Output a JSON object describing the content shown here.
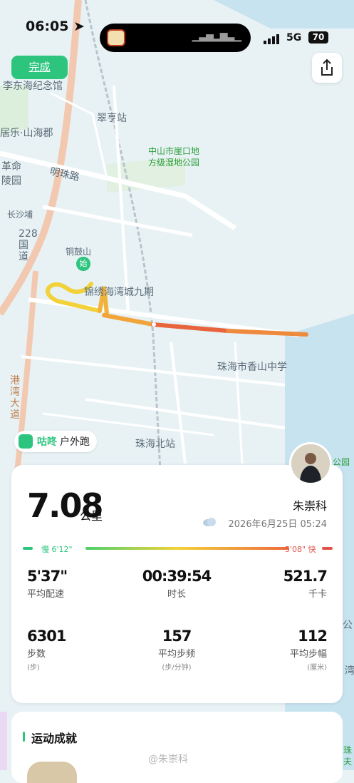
{
  "status_bar": {
    "time": "06:05",
    "network": "5G",
    "battery": "70"
  },
  "top_controls": {
    "done_label": "完成",
    "share_icon": "share-icon"
  },
  "map": {
    "labels": {
      "l1": "李东海纪念馆",
      "l2": "居乐·山海郡",
      "l3": "翠亨站",
      "l4": "中山市崖口地",
      "l4b": "方级湿地公园",
      "l5": "革命",
      "l5b": "陵园",
      "l6": "明珠路",
      "l7": "长沙埔",
      "l8": "228国道",
      "l9": "铜鼓山",
      "l10": "始",
      "l11": "锦绣海湾城九期",
      "l12": "珠海市香山中学",
      "l13": "港湾大道",
      "l14": "珠海北站",
      "l15": "公园",
      "l16": "公",
      "l17": "珠",
      "l17b": "夫",
      "l18": "湾"
    },
    "route_colors": [
      "#f2d23a",
      "#f0b23a",
      "#ee8a3c",
      "#e8643c"
    ]
  },
  "gudong_chip": {
    "name": "咕咚",
    "activity": "户外跑"
  },
  "summary": {
    "distance": "7.08",
    "distance_unit": "公里",
    "user_name": "朱崇科",
    "date": "2026年6月25日 05:24",
    "pace_slow": "慢 6'12\"",
    "pace_fast": "5'08\" 快",
    "stats": {
      "avg_pace": {
        "value": "5'37\"",
        "label": "平均配速"
      },
      "duration": {
        "value": "00:39:54",
        "label": "时长"
      },
      "calories": {
        "value": "521.7",
        "label": "千卡"
      },
      "steps": {
        "value": "6301",
        "label": "步数",
        "unit": "(步)"
      },
      "cadence": {
        "value": "157",
        "label": "平均步频",
        "unit": "(步/分钟)"
      },
      "stride": {
        "value": "112",
        "label": "平均步幅",
        "unit": "(厘米)"
      }
    }
  },
  "achievements": {
    "title": "运动成就"
  },
  "watermark": "@朱崇科"
}
